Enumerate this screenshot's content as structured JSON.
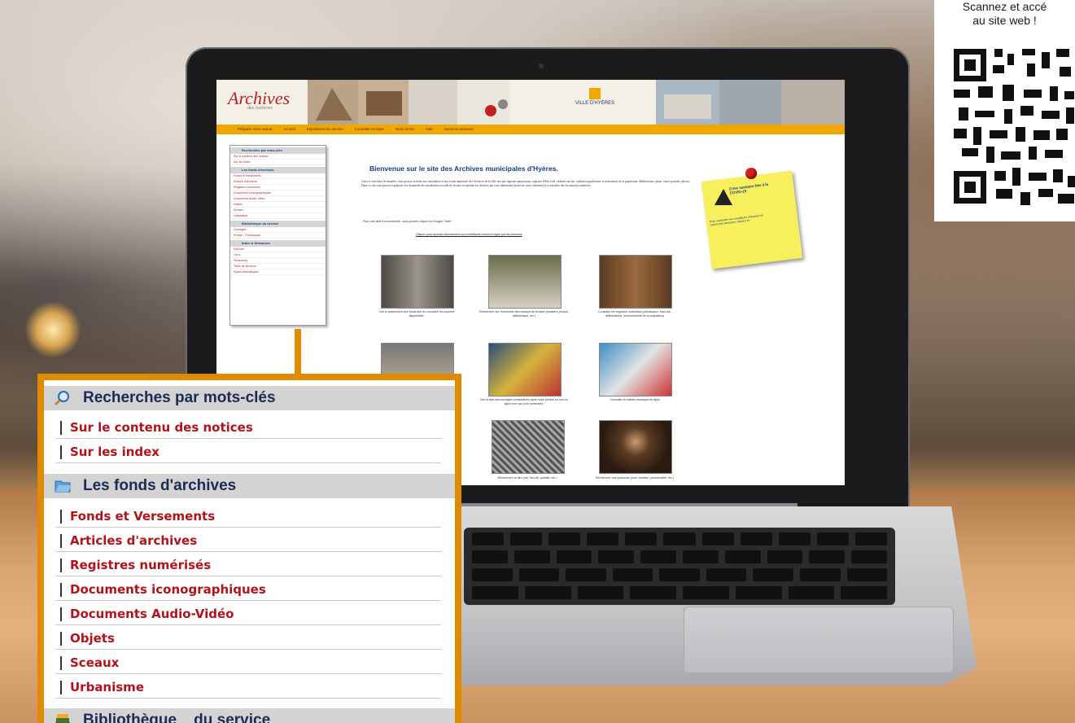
{
  "qr": {
    "line1": "Scannez et accé",
    "line2": "au site web !"
  },
  "site": {
    "logo": "Archives",
    "logo_sub": "des Archives",
    "city": "VILLE D'HYÈRES",
    "nav": [
      "Préparer votre venue",
      "Accueil",
      "Expositions du service",
      "Consulter en ligne",
      "Nous écrire",
      "Aide",
      "Services annexes"
    ],
    "welcome": "Bienvenue sur le site des Archives municipales d'Hyères.",
    "intro": "Grâce à cette base de données, vous pouvez accéder aux inventaires et aux fonds numérisés des Archives de la ville tels que registres paroissiaux, registres d'état-civil, cadastre ancien, cadastre napoléonien, recensements de la population, délibérations, plans, cartes postales, photos. Dans ce site vous pouvez à préparer vos demandes de consultation en salle de lecture en repérant les dossiers qui vous intéressent (notez les cotes obtenues) et à consulter des documents numérisés.",
    "note": "Pour une aide à la recherche, vous pouvez cliquer sur l'onglet \"Aide\"",
    "link": "Cliquez pour accéder directement aux nouveautés mises en ligne par les Archives",
    "postit_title": "Crise sanitaire liée à la COVID-19",
    "postit_text": "Pour connaître les conditions d'accueil en raison des mesures, cliquez ici",
    "captions": [
      "Voir le classement des fonds afin de connaître les sources disponibles.",
      "Rechercher sur l'ensemble des champs de la base (dossiers, photos, bibliothèque, etc.)",
      "Consulter les registres numérisés (paroissiaux, état-civil, délibérations, recensements de la population)",
      "Voir la liste des ouvrages consultables dans notre service ou non en ligne ceux qui sont numérisés.",
      "Consulter le bulletin municipal en ligne",
      "Rechercher un lieu (rue, lieu-dit, quartier, etc.)",
      "Rechercher une personne (nom, fonction, personnalité, etc.)"
    ],
    "side_menu": {
      "head1": "Recherches par mots-clés",
      "items1": [
        "Sur le contenu des notices",
        "Sur les index"
      ],
      "head2": "Les fonds d'archives",
      "items2": [
        "Fonds et Versements",
        "Articles d'archives",
        "Registres numérisés",
        "Documents iconographiques",
        "Documents Audio-Vidéo",
        "Objets",
        "Sceaux",
        "Urbanisme"
      ],
      "head3": "Bibliothèque du service",
      "items3": [
        "Ouvrages",
        "Presse - Périodiques"
      ],
      "head4": "Index & thésaurus",
      "items4": [
        "Édifices",
        "Lieux",
        "Personnes",
        "Table de services",
        "Sujets thématiques"
      ]
    }
  },
  "zoom": {
    "head1": "Recherches par mots-clés",
    "items1": [
      "Sur le contenu des notices",
      "Sur les index"
    ],
    "head2": "Les fonds d'archives",
    "items2": [
      "Fonds et Versements",
      "Articles d'archives",
      "Registres numérisés",
      "Documents iconographiques",
      "Documents Audio-Vidéo",
      "Objets",
      "Sceaux",
      "Urbanisme"
    ],
    "head3": "Bibliothèque    du service"
  },
  "keyboard": {
    "row1": [
      "",
      "",
      "",
      "",
      "",
      "",
      "",
      "",
      "",
      "",
      "",
      ""
    ]
  },
  "colors": {
    "accent": "#e08a00",
    "menu_text": "#b3121a",
    "head_text": "#1c2b55"
  }
}
